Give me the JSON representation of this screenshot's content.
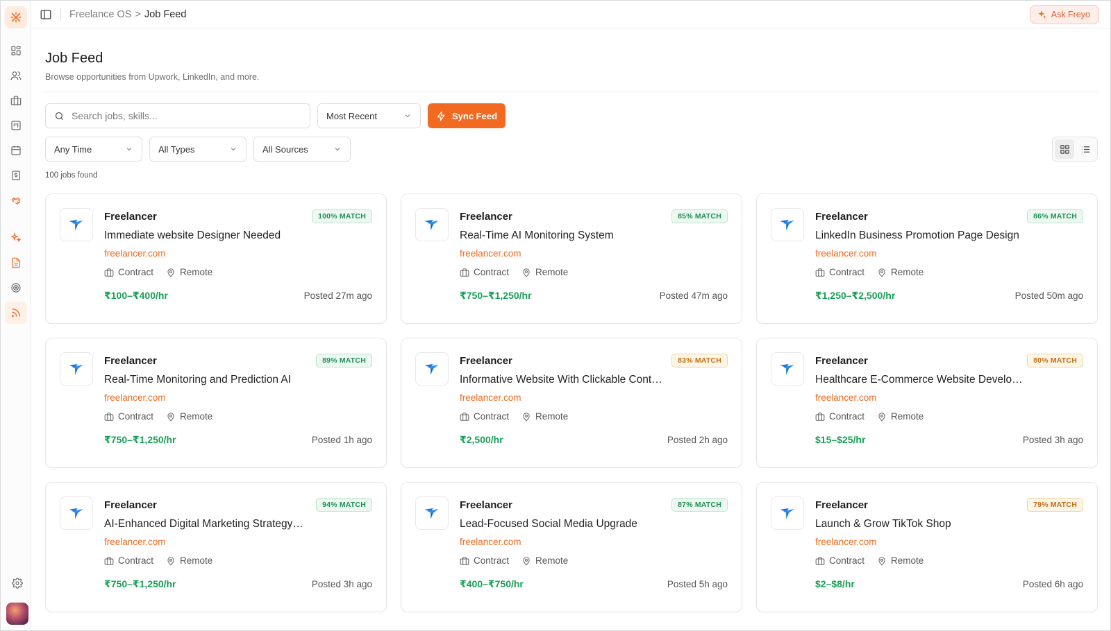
{
  "breadcrumb": {
    "root": "Freelance OS",
    "separator": ">",
    "current": "Job Feed"
  },
  "topbar": {
    "ask_label": "Ask Freyo"
  },
  "page": {
    "title": "Job Feed",
    "subtitle": "Browse opportunities from Upwork, LinkedIn, and more."
  },
  "search": {
    "placeholder": "Search jobs, skills..."
  },
  "sort": {
    "value": "Most Recent"
  },
  "sync": {
    "label": "Sync Feed"
  },
  "filters": {
    "time": "Any Time",
    "type": "All Types",
    "source": "All Sources"
  },
  "results": {
    "count_text": "100 jobs found"
  },
  "colors": {
    "accent": "#f26a21",
    "rate": "#17a055",
    "match_high": "#1f8f55",
    "match_mid": "#c76e14"
  },
  "sidebar": {
    "items": [
      {
        "icon": "dashboard-icon"
      },
      {
        "icon": "users-icon"
      },
      {
        "icon": "briefcase-icon"
      },
      {
        "icon": "kanban-icon"
      },
      {
        "icon": "calendar-icon"
      },
      {
        "icon": "invoice-icon"
      },
      {
        "icon": "handshake-icon"
      },
      {
        "icon": "sparkle-icon"
      },
      {
        "icon": "document-icon"
      },
      {
        "icon": "target-icon"
      },
      {
        "icon": "rss-feed-icon"
      },
      {
        "icon": "settings-icon"
      }
    ]
  },
  "jobs": [
    {
      "company": "Freelancer",
      "match": "100% MATCH",
      "title": "Immediate website Designer Needed",
      "source": "freelancer.com",
      "type": "Contract",
      "location": "Remote",
      "rate": "₹100–₹400/hr",
      "posted": "Posted 27m ago"
    },
    {
      "company": "Freelancer",
      "match": "85% MATCH",
      "title": "Real-Time AI Monitoring System",
      "source": "freelancer.com",
      "type": "Contract",
      "location": "Remote",
      "rate": "₹750–₹1,250/hr",
      "posted": "Posted 47m ago"
    },
    {
      "company": "Freelancer",
      "match": "86% MATCH",
      "title": "LinkedIn Business Promotion Page Design",
      "source": "freelancer.com",
      "type": "Contract",
      "location": "Remote",
      "rate": "₹1,250–₹2,500/hr",
      "posted": "Posted 50m ago"
    },
    {
      "company": "Freelancer",
      "match": "89% MATCH",
      "title": "Real-Time Monitoring and Prediction AI",
      "source": "freelancer.com",
      "type": "Contract",
      "location": "Remote",
      "rate": "₹750–₹1,250/hr",
      "posted": "Posted 1h ago"
    },
    {
      "company": "Freelancer",
      "match": "83% MATCH",
      "title": "Informative Website With Clickable Contacts",
      "source": "freelancer.com",
      "type": "Contract",
      "location": "Remote",
      "rate": "₹2,500/hr",
      "posted": "Posted 2h ago"
    },
    {
      "company": "Freelancer",
      "match": "80% MATCH",
      "title": "Healthcare E-Commerce Website Development",
      "source": "freelancer.com",
      "type": "Contract",
      "location": "Remote",
      "rate": "$15–$25/hr",
      "posted": "Posted 3h ago"
    },
    {
      "company": "Freelancer",
      "match": "94% MATCH",
      "title": "AI-Enhanced Digital Marketing Strategy…",
      "source": "freelancer.com",
      "type": "Contract",
      "location": "Remote",
      "rate": "₹750–₹1,250/hr",
      "posted": "Posted 3h ago"
    },
    {
      "company": "Freelancer",
      "match": "87% MATCH",
      "title": "Lead-Focused Social Media Upgrade",
      "source": "freelancer.com",
      "type": "Contract",
      "location": "Remote",
      "rate": "₹400–₹750/hr",
      "posted": "Posted 5h ago"
    },
    {
      "company": "Freelancer",
      "match": "79% MATCH",
      "title": "Launch & Grow TikTok Shop",
      "source": "freelancer.com",
      "type": "Contract",
      "location": "Remote",
      "rate": "$2–$8/hr",
      "posted": "Posted 6h ago"
    }
  ]
}
